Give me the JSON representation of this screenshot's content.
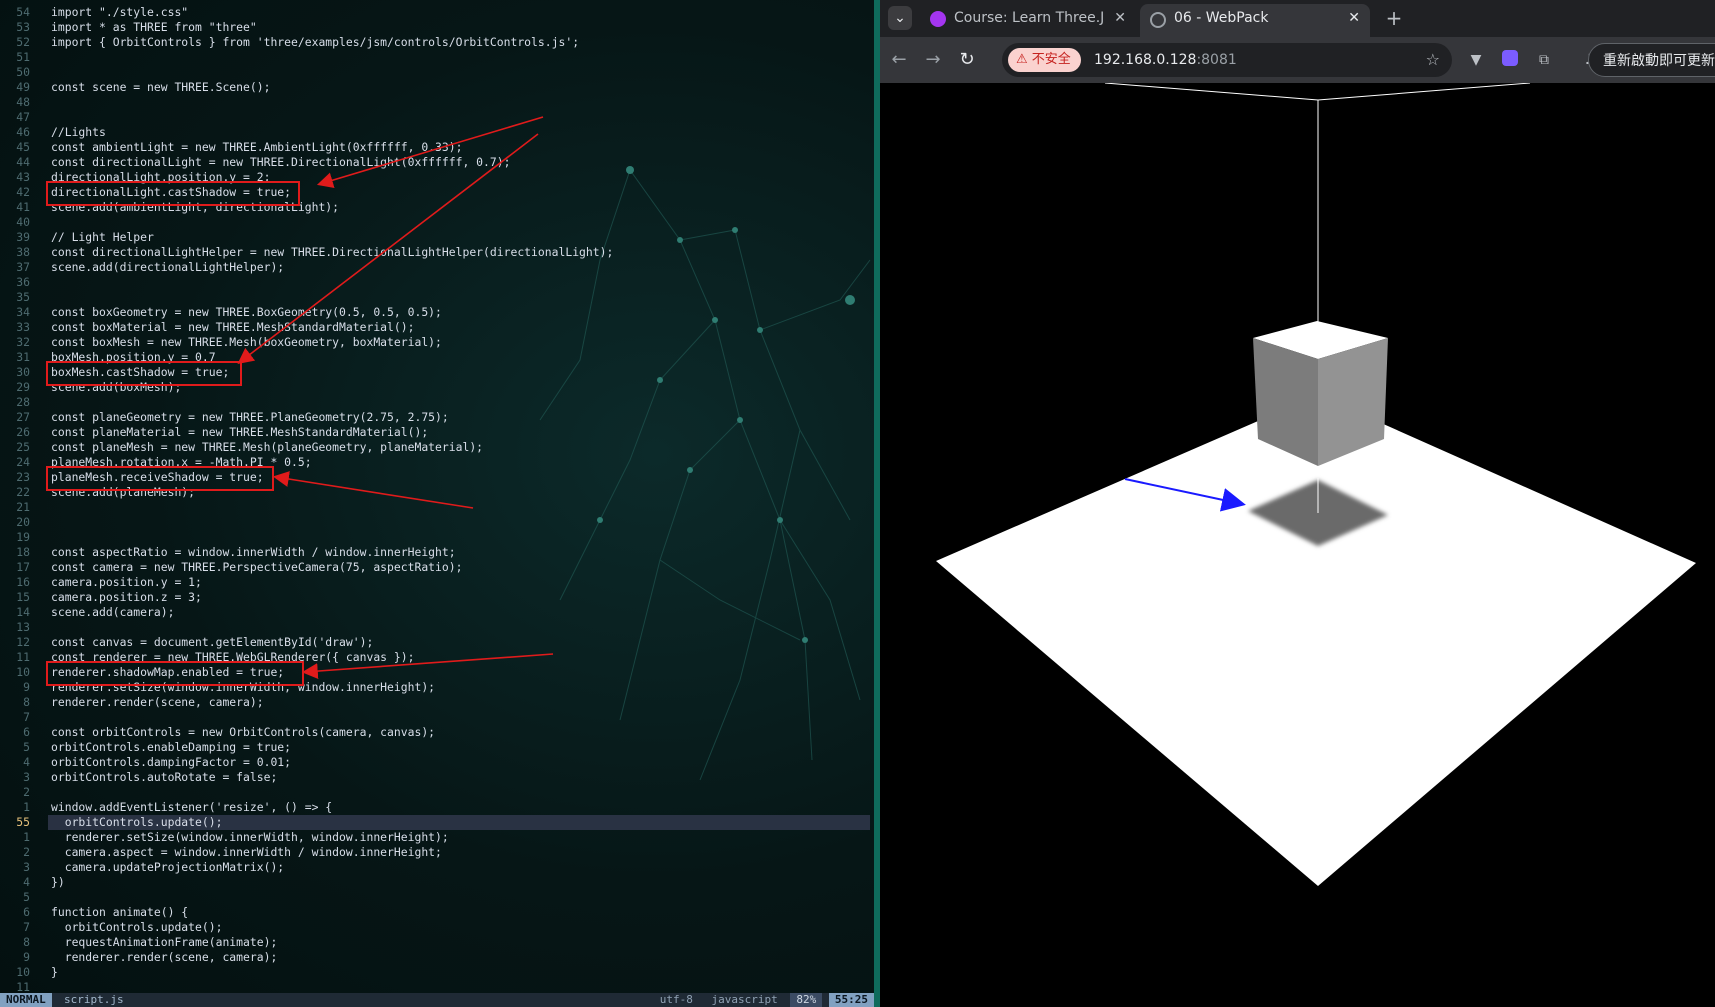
{
  "editor": {
    "lines": [
      {
        "n": "54",
        "t": "import \"./style.css\""
      },
      {
        "n": "53",
        "t": "import * as THREE from \"three\""
      },
      {
        "n": "52",
        "t": "import { OrbitControls } from 'three/examples/jsm/controls/OrbitControls.js';"
      },
      {
        "n": "51",
        "t": ""
      },
      {
        "n": "50",
        "t": ""
      },
      {
        "n": "49",
        "t": "const scene = new THREE.Scene();"
      },
      {
        "n": "48",
        "t": ""
      },
      {
        "n": "47",
        "t": ""
      },
      {
        "n": "46",
        "t": "//Lights"
      },
      {
        "n": "45",
        "t": "const ambientLight = new THREE.AmbientLight(0xffffff, 0.33);"
      },
      {
        "n": "44",
        "t": "const directionalLight = new THREE.DirectionalLight(0xffffff, 0.7);"
      },
      {
        "n": "43",
        "t": "directionalLight.position.y = 2;"
      },
      {
        "n": "42",
        "t": "directionalLight.castShadow = true;"
      },
      {
        "n": "41",
        "t": "scene.add(ambientLight, directionalLight);"
      },
      {
        "n": "40",
        "t": ""
      },
      {
        "n": "39",
        "t": "// Light Helper"
      },
      {
        "n": "38",
        "t": "const directionalLightHelper = new THREE.DirectionalLightHelper(directionalLight);"
      },
      {
        "n": "37",
        "t": "scene.add(directionalLightHelper);"
      },
      {
        "n": "36",
        "t": ""
      },
      {
        "n": "35",
        "t": ""
      },
      {
        "n": "34",
        "t": "const boxGeometry = new THREE.BoxGeometry(0.5, 0.5, 0.5);"
      },
      {
        "n": "33",
        "t": "const boxMaterial = new THREE.MeshStandardMaterial();"
      },
      {
        "n": "32",
        "t": "const boxMesh = new THREE.Mesh(boxGeometry, boxMaterial);"
      },
      {
        "n": "31",
        "t": "boxMesh.position.y = 0.7"
      },
      {
        "n": "30",
        "t": "boxMesh.castShadow = true;"
      },
      {
        "n": "29",
        "t": "scene.add(boxMesh);"
      },
      {
        "n": "28",
        "t": ""
      },
      {
        "n": "27",
        "t": "const planeGeometry = new THREE.PlaneGeometry(2.75, 2.75);"
      },
      {
        "n": "26",
        "t": "const planeMaterial = new THREE.MeshStandardMaterial();"
      },
      {
        "n": "25",
        "t": "const planeMesh = new THREE.Mesh(planeGeometry, planeMaterial);"
      },
      {
        "n": "24",
        "t": "planeMesh.rotation.x = -Math.PI * 0.5;"
      },
      {
        "n": "23",
        "t": "planeMesh.receiveShadow = true;"
      },
      {
        "n": "22",
        "t": "scene.add(planeMesh);"
      },
      {
        "n": "21",
        "t": ""
      },
      {
        "n": "20",
        "t": ""
      },
      {
        "n": "19",
        "t": ""
      },
      {
        "n": "18",
        "t": "const aspectRatio = window.innerWidth / window.innerHeight;"
      },
      {
        "n": "17",
        "t": "const camera = new THREE.PerspectiveCamera(75, aspectRatio);"
      },
      {
        "n": "16",
        "t": "camera.position.y = 1;"
      },
      {
        "n": "15",
        "t": "camera.position.z = 3;"
      },
      {
        "n": "14",
        "t": "scene.add(camera);"
      },
      {
        "n": "13",
        "t": ""
      },
      {
        "n": "12",
        "t": "const canvas = document.getElementById('draw');"
      },
      {
        "n": "11",
        "t": "const renderer = new THREE.WebGLRenderer({ canvas });"
      },
      {
        "n": "10",
        "t": "renderer.shadowMap.enabled = true;"
      },
      {
        "n": "9",
        "t": "renderer.setSize(window.innerWidth, window.innerHeight);"
      },
      {
        "n": "8",
        "t": "renderer.render(scene, camera);"
      },
      {
        "n": "7",
        "t": ""
      },
      {
        "n": "6",
        "t": "const orbitControls = new OrbitControls(camera, canvas);"
      },
      {
        "n": "5",
        "t": "orbitControls.enableDamping = true;"
      },
      {
        "n": "4",
        "t": "orbitControls.dampingFactor = 0.01;"
      },
      {
        "n": "3",
        "t": "orbitControls.autoRotate = false;"
      },
      {
        "n": "2",
        "t": ""
      },
      {
        "n": "1",
        "t": "window.addEventListener('resize', () => {"
      },
      {
        "n": "55",
        "t": "  orbitControls.update();",
        "current": true
      },
      {
        "n": "1",
        "t": "  renderer.setSize(window.innerWidth, window.innerHeight);"
      },
      {
        "n": "2",
        "t": "  camera.aspect = window.innerWidth / window.innerHeight;"
      },
      {
        "n": "3",
        "t": "  camera.updateProjectionMatrix();"
      },
      {
        "n": "4",
        "t": "})"
      },
      {
        "n": "5",
        "t": ""
      },
      {
        "n": "6",
        "t": "function animate() {"
      },
      {
        "n": "7",
        "t": "  orbitControls.update();"
      },
      {
        "n": "8",
        "t": "  requestAnimationFrame(animate);"
      },
      {
        "n": "9",
        "t": "  renderer.render(scene, camera);"
      },
      {
        "n": "10",
        "t": "}"
      },
      {
        "n": "11",
        "t": ""
      }
    ],
    "highlighted_line_numbers": [
      "42",
      "30",
      "23",
      "10"
    ]
  },
  "statusline": {
    "mode": "NORMAL",
    "filename": "script.js",
    "encoding": "utf-8",
    "filetype": "javascript",
    "percent": "82%",
    "position": "55:25"
  },
  "browser": {
    "tabs": [
      {
        "title": "Course: Learn Three.Js a",
        "active": false
      },
      {
        "title": "06 - WebPack",
        "active": true
      }
    ],
    "security_label": "不安全",
    "url_host": "192.168.0.128",
    "url_port": ":8081",
    "relaunch_label": "重新啟動即可更新",
    "colors": {
      "accent_red": "#e01b1b",
      "annotation_blue": "#1a1aff",
      "plane": "#ffffff",
      "box_side": "#8a8a8a"
    }
  }
}
